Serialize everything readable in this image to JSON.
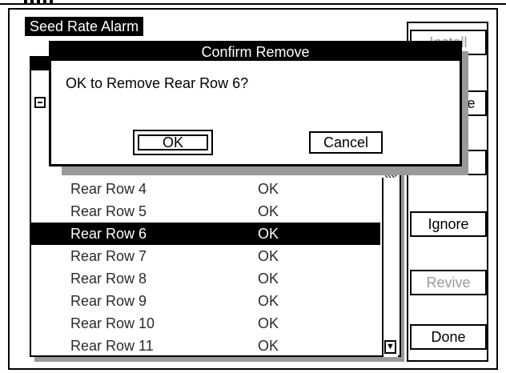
{
  "window": {
    "title": "Seed Rate Alarm"
  },
  "side_buttons": {
    "install": {
      "label": "Install",
      "state": "disabled"
    },
    "remove": {
      "label": "Remove",
      "state": "enabled"
    },
    "third": {
      "label": "",
      "state": "enabled"
    },
    "ignore": {
      "label": "Ignore",
      "state": "enabled"
    },
    "revive": {
      "label": "Revive",
      "state": "disabled"
    },
    "done": {
      "label": "Done",
      "state": "enabled"
    }
  },
  "list": {
    "rows": [
      {
        "name": "Rear Row 4",
        "status": "OK",
        "selected": false
      },
      {
        "name": "Rear Row 5",
        "status": "OK",
        "selected": false
      },
      {
        "name": "Rear Row 6",
        "status": "OK",
        "selected": true
      },
      {
        "name": "Rear Row 7",
        "status": "OK",
        "selected": false
      },
      {
        "name": "Rear Row 8",
        "status": "OK",
        "selected": false
      },
      {
        "name": "Rear Row 9",
        "status": "OK",
        "selected": false
      },
      {
        "name": "Rear Row 10",
        "status": "OK",
        "selected": false
      },
      {
        "name": "Rear Row 11",
        "status": "OK",
        "selected": false
      }
    ]
  },
  "dialog": {
    "title": "Confirm Remove",
    "message": "OK to Remove Rear Row 6?",
    "ok_label": "OK",
    "cancel_label": "Cancel"
  },
  "colors": {
    "foreground": "#000000",
    "background": "#ffffff",
    "disabled_text": "#9a9a9a",
    "shadow": "#9a9a9a"
  }
}
